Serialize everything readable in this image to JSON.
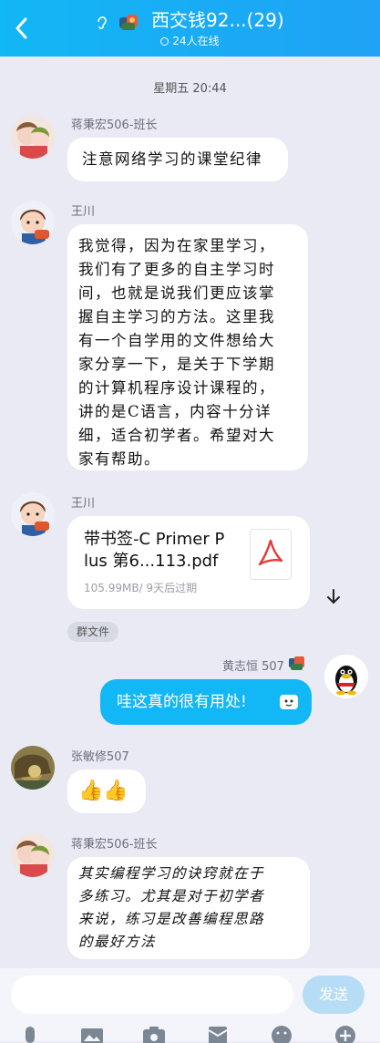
{
  "header": {
    "title": "西交钱92...(29)",
    "online": "24人在线"
  },
  "timestamp": "星期五 20:44",
  "messages": [
    {
      "sender": "蒋秉宏506-班长",
      "text": "注意网络学习的课堂纪律"
    },
    {
      "sender": "王川",
      "lines": [
        "我觉得，因为在家里学习，",
        "我们有了更多的自主学习时",
        "间，也就是说我们更应该掌",
        "握自主学习的方法。这里我",
        "有一个自学用的文件想给大",
        "家分享一下，是关于下学期",
        "的计算机程序设计课程的，",
        "讲的是C语言，内容十分详",
        "细，适合初学者。希望对大",
        "家有帮助。"
      ]
    },
    {
      "sender": "王川",
      "file_name_lines": [
        "带书签-C Primer P",
        "lus  第6...113.pdf"
      ],
      "file_meta": "105.99MB/ 9天后过期",
      "tag": "群文件"
    },
    {
      "sender": "黄志恒 507",
      "text": "哇这真的很有用处!"
    },
    {
      "sender": "张敏修507",
      "text": "👍👍"
    },
    {
      "sender": "蒋秉宏506-班长",
      "lines": [
        "其实编程学习的诀窍就在于",
        "多练习。尤其是对于初学者",
        "来说，练习是改善编程思路",
        "的最好方法"
      ]
    }
  ],
  "input": {
    "send_label": "发送"
  },
  "icons": [
    "back-icon",
    "ear-icon",
    "mic-icon",
    "image-icon",
    "camera-icon",
    "red-packet-icon",
    "emoji-icon",
    "plus-icon",
    "pdf-icon",
    "download-icon"
  ]
}
